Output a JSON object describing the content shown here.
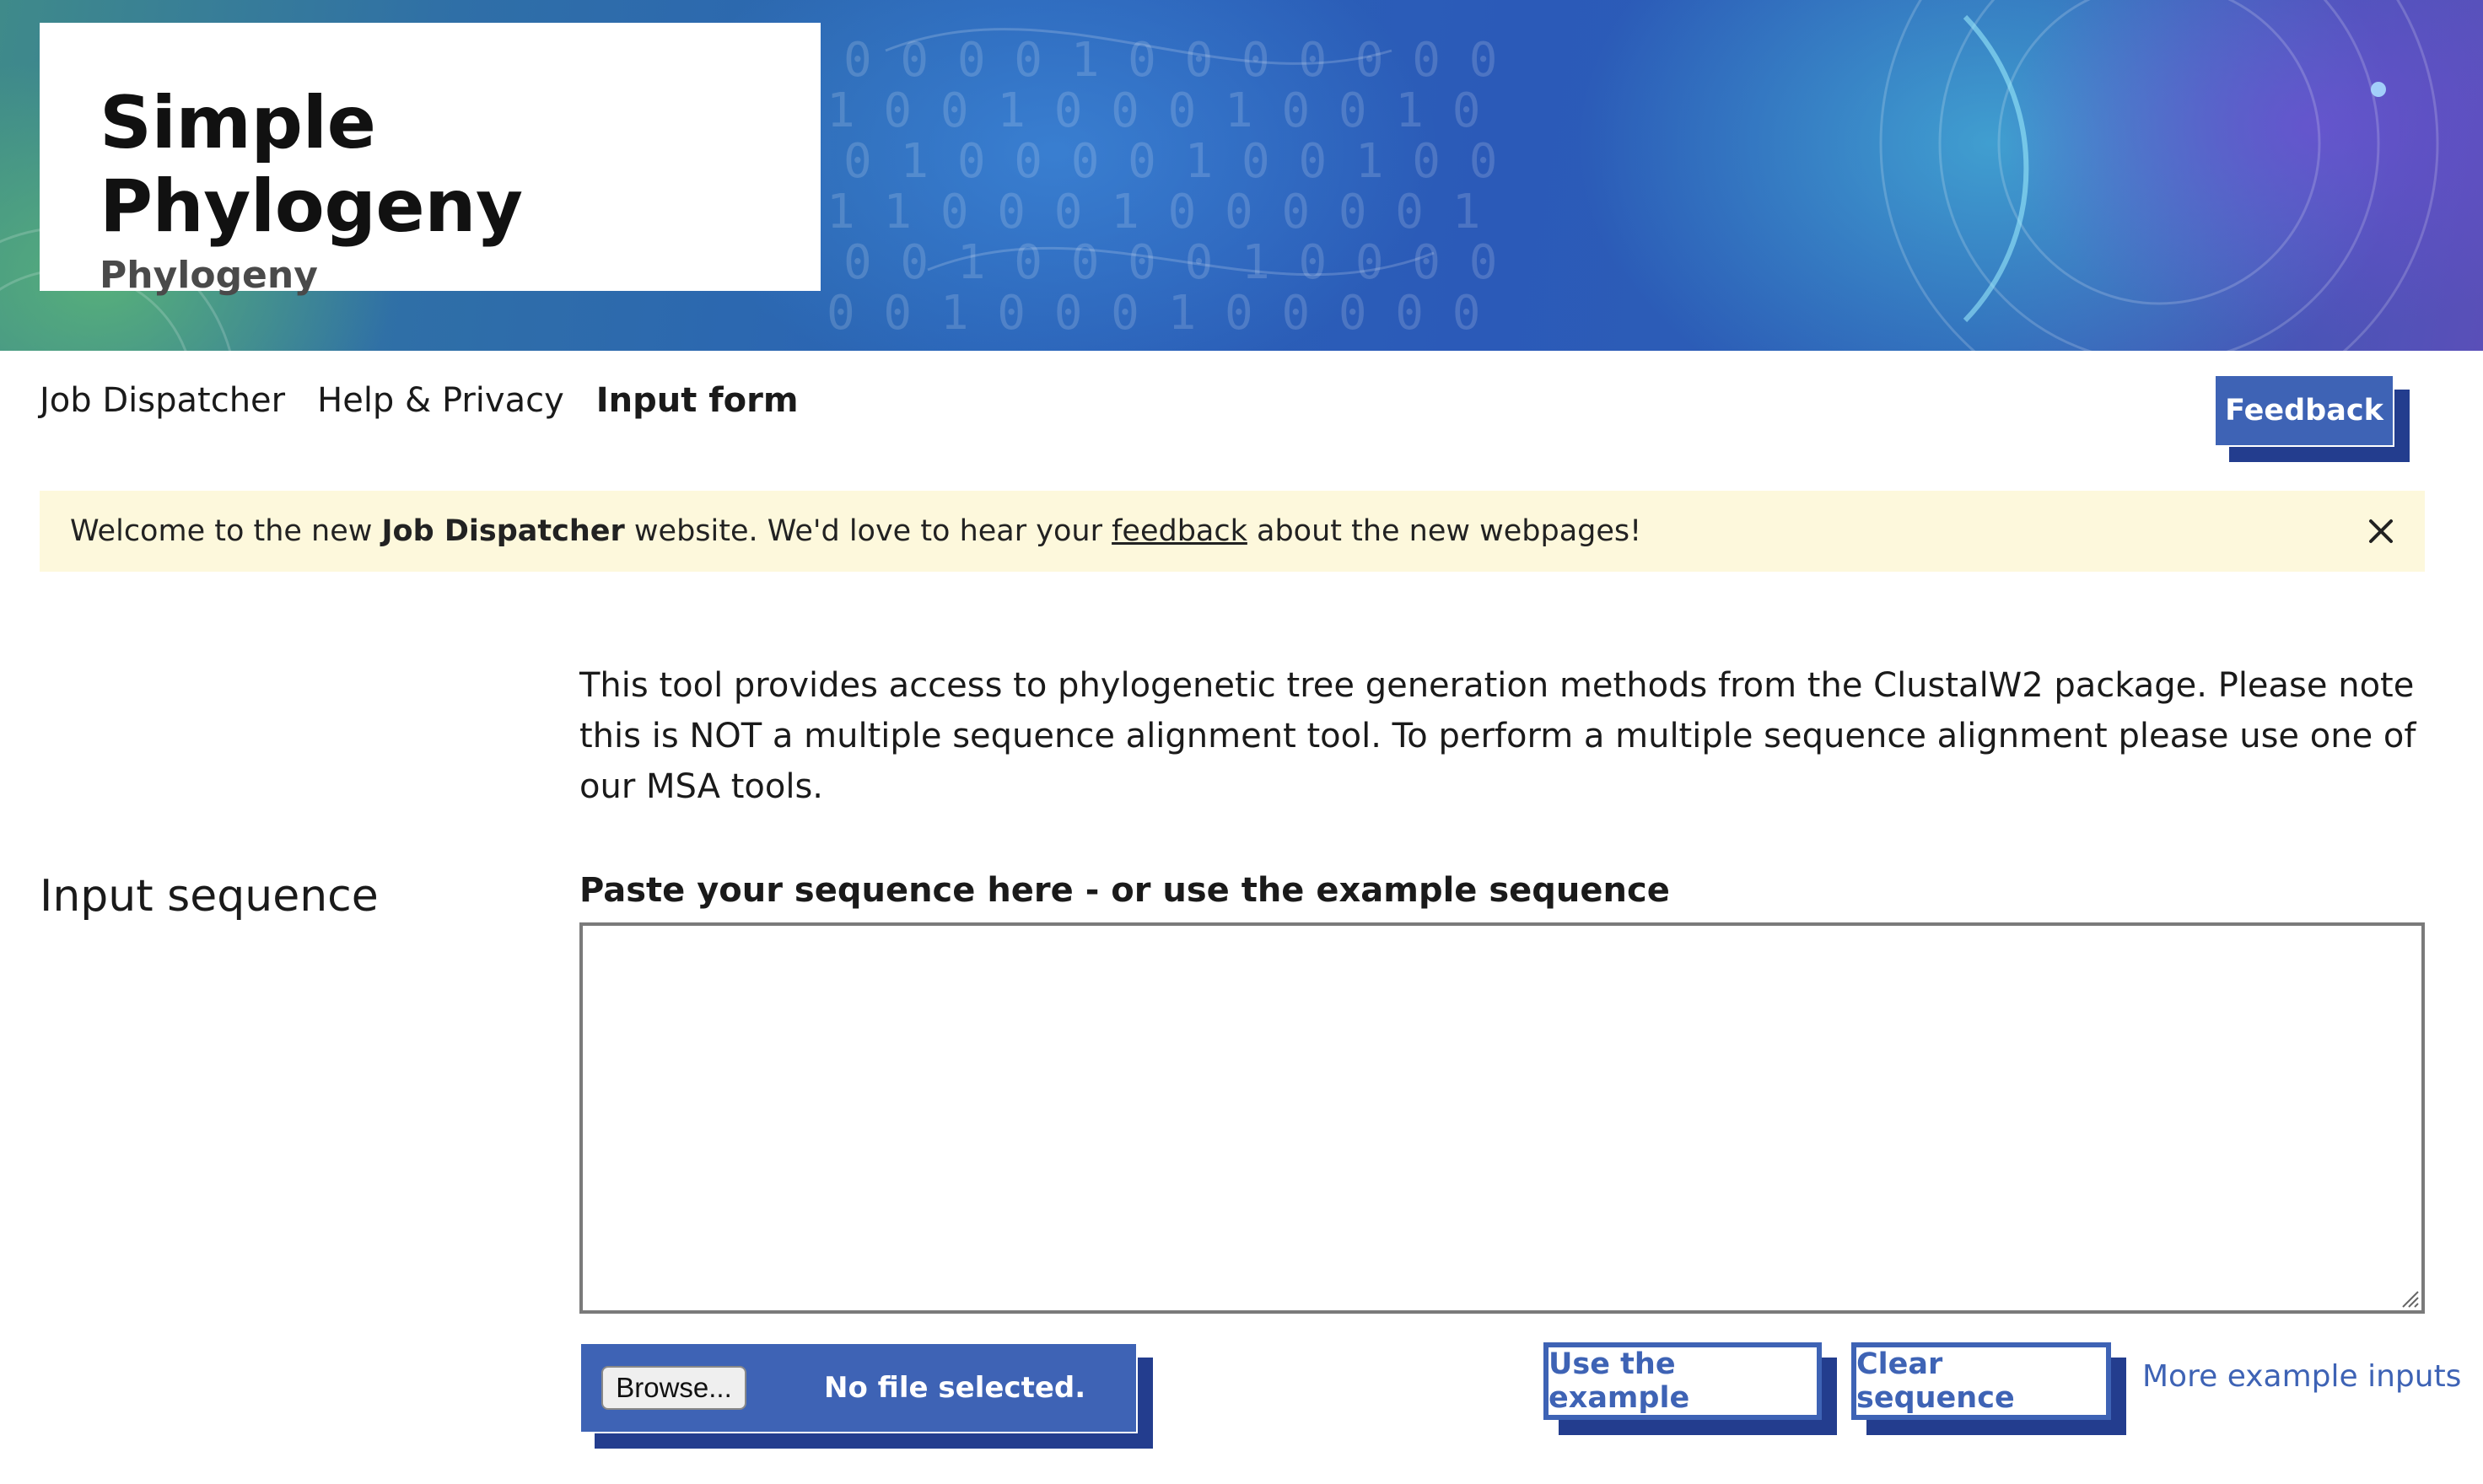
{
  "header": {
    "title": "Simple Phylogeny",
    "subtitle": "Phylogeny"
  },
  "nav": {
    "items": [
      {
        "label": "Job Dispatcher",
        "active": false
      },
      {
        "label": "Help & Privacy",
        "active": false
      },
      {
        "label": "Input form",
        "active": true
      }
    ],
    "feedback_label": "Feedback"
  },
  "notice": {
    "text_before": "Welcome to the new ",
    "bold": "Job Dispatcher",
    "text_mid": " website. We'd love to hear your ",
    "link": "feedback",
    "text_after": " about the new webpages!",
    "close_icon": "close-icon"
  },
  "main": {
    "description": "This tool provides access to phylogenetic tree generation methods from the ClustalW2 package. Please note this is NOT a multiple sequence alignment tool. To perform a multiple sequence alignment please use one of our MSA tools.",
    "section_label": "Input sequence",
    "field_label": "Paste your sequence here - or use the example sequence",
    "sequence_value": "",
    "upload": {
      "browse_label": "Browse...",
      "status": "No file selected."
    },
    "use_example_label": "Use the example",
    "clear_label": "Clear sequence",
    "more_examples_label": "More example inputs"
  },
  "colors": {
    "accent": "#3e63b5",
    "accent_shadow": "#233d8e",
    "notice_bg": "#fdf8dc"
  }
}
